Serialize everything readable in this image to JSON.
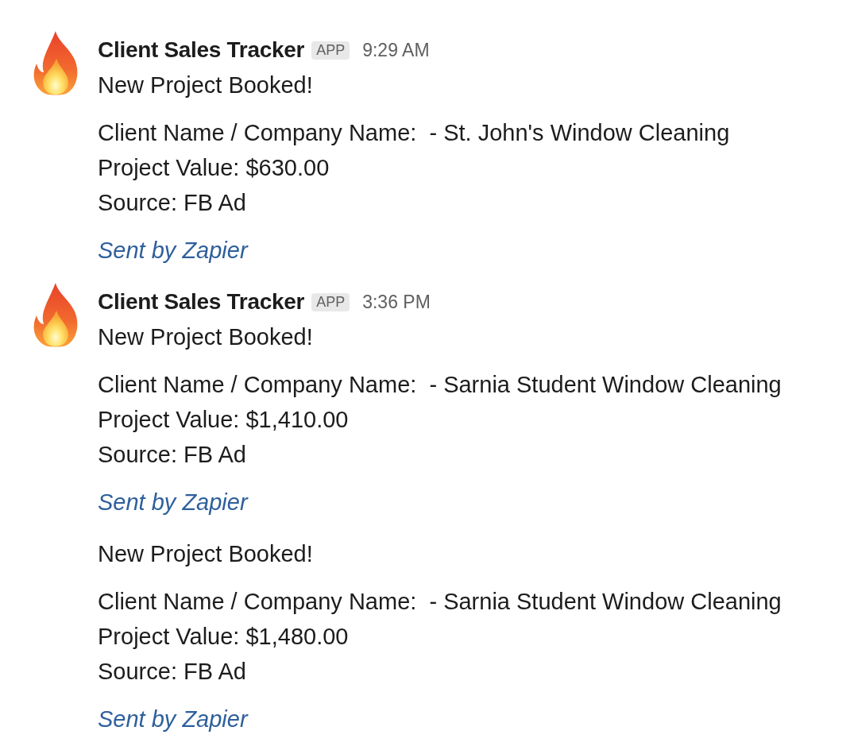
{
  "groups": [
    {
      "sender": "Client Sales Tracker",
      "badge": "APP",
      "time": "9:29 AM",
      "posts": [
        {
          "title": "New Project Booked!",
          "fields": [
            "Client Name / Company Name:  - St. John's Window Cleaning",
            "Project Value: $630.00",
            "Source: FB Ad"
          ],
          "footer": "Sent by Zapier"
        }
      ]
    },
    {
      "sender": "Client Sales Tracker",
      "badge": "APP",
      "time": "3:36 PM",
      "posts": [
        {
          "title": "New Project Booked!",
          "fields": [
            "Client Name / Company Name:  - Sarnia Student Window Cleaning",
            "Project Value: $1,410.00",
            "Source: FB Ad"
          ],
          "footer": "Sent by Zapier"
        },
        {
          "title": "New Project Booked!",
          "fields": [
            "Client Name / Company Name:  - Sarnia Student Window Cleaning",
            "Project Value: $1,480.00",
            "Source: FB Ad"
          ],
          "footer": "Sent by Zapier"
        }
      ]
    }
  ]
}
